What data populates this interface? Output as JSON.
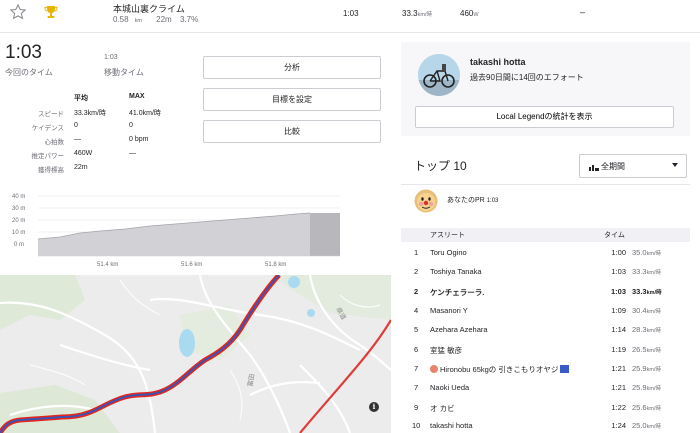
{
  "segment": {
    "name": "本城山裏クライム",
    "distance": "0.58",
    "distance_unit": "km",
    "elevation": "22m",
    "grade": "3.7%",
    "time": "1:03",
    "speed": "33.3",
    "speed_unit": "km/時",
    "power": "460",
    "power_unit": "W",
    "dash": "–"
  },
  "summary": {
    "elapsed_time": "1:03",
    "elapsed_label": "今回のタイム",
    "moving_time": "1:03",
    "moving_label": "移動タイム",
    "col_avg": "平均",
    "col_max": "MAX",
    "rows": [
      {
        "label": "スピード",
        "avg": "33.3km/時",
        "max": "41.0km/時"
      },
      {
        "label": "ケイデンス",
        "avg": "0",
        "max": "0"
      },
      {
        "label": "心拍数",
        "avg": "—",
        "max": "0 bpm"
      },
      {
        "label": "推定パワー",
        "avg": "460W",
        "max": "—"
      },
      {
        "label": "獲得標高",
        "avg": "22m",
        "max": ""
      }
    ]
  },
  "buttons": {
    "analysis": "分析",
    "set_goal": "目標を設定",
    "compare": "比較"
  },
  "elevation_chart": {
    "y_ticks": [
      "40 m",
      "30 m",
      "20 m",
      "10 m",
      "0 m"
    ],
    "x_ticks": [
      "51.4 km",
      "51.6 km",
      "51.8 km"
    ],
    "colors": {
      "fill": "#cfcfd4",
      "line": "#9e9ea6",
      "end_fill": "#b5b5b9"
    }
  },
  "map": {
    "labels": [
      "県道",
      "富田"
    ],
    "route_colors": {
      "outer": "#e4261d",
      "inner": "#3d53b3"
    },
    "info_icon": "i"
  },
  "profile": {
    "name": "takashi hotta",
    "efforts": "過去90日間に14回のエフォート",
    "legend_button": "Local Legendの統計を表示"
  },
  "leaderboard": {
    "title": "トップ 10",
    "period_label": "全期間",
    "pr_label": "あなたのPR",
    "pr_time": "1:03",
    "col_athlete": "アスリート",
    "col_time": "タイム",
    "rows": [
      {
        "rank": "1",
        "name": "Toru Ogino",
        "time": "1:00",
        "speed": "35.0",
        "unit": "km/時"
      },
      {
        "rank": "2",
        "name": "Toshiya Tanaka",
        "time": "1:03",
        "speed": "33.3",
        "unit": "km/時"
      },
      {
        "rank": "2",
        "name": "ケンチェラーラ.",
        "time": "1:03",
        "speed": "33.3",
        "unit": "km/時",
        "me": true
      },
      {
        "rank": "4",
        "name": "Masanori Y",
        "time": "1:09",
        "speed": "30.4",
        "unit": "km/時"
      },
      {
        "rank": "5",
        "name": "Azehara Azehara",
        "time": "1:14",
        "speed": "28.3",
        "unit": "km/時"
      },
      {
        "rank": "6",
        "name": "室猛 敏彦",
        "time": "1:19",
        "speed": "26.5",
        "unit": "km/時"
      },
      {
        "rank": "7",
        "name": "Hironobu 65kgの 引きこもりオヤジ",
        "time": "1:21",
        "speed": "25.9",
        "unit": "km/時"
      },
      {
        "rank": "7",
        "name": "Naoki Ueda",
        "time": "1:21",
        "speed": "25.9",
        "unit": "km/時"
      },
      {
        "rank": "9",
        "name": "オ カビ",
        "time": "1:22",
        "speed": "25.6",
        "unit": "km/時"
      },
      {
        "rank": "10",
        "name": "takashi hotta",
        "time": "1:24",
        "speed": "25.0",
        "unit": "km/時"
      }
    ]
  }
}
